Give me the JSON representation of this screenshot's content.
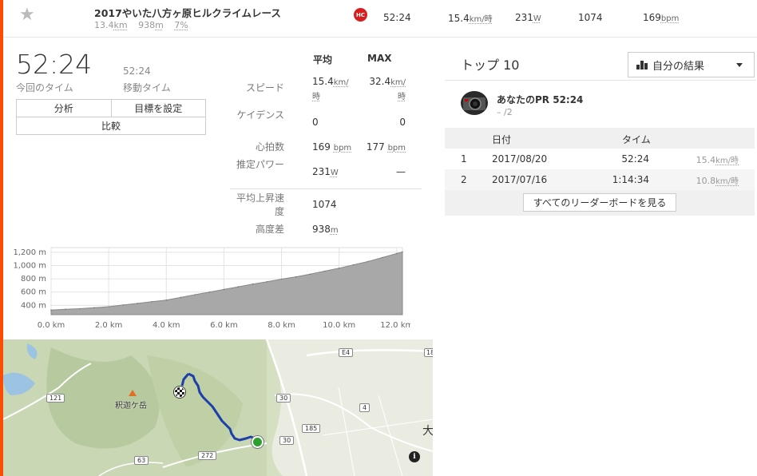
{
  "colors": {
    "accent": "#fc4c02",
    "route": "#1c3faa",
    "hc_badge": "#d61e1e",
    "end_marker": "#2ca02c",
    "elev_fill": "#a8a8a8"
  },
  "segment": {
    "star_icon": "★",
    "title": "2017やいた八方ヶ原ヒルクライムレース",
    "distance_val": "13.4",
    "distance_unit": "km",
    "elev_val": "938",
    "elev_unit": "m",
    "grade": "7%",
    "category": "HC",
    "time": "52:24",
    "speed_val": "15.4",
    "speed_unit": "km/時",
    "power_val": "231",
    "power_unit": "W",
    "vam": "1074",
    "hr_val": "169",
    "hr_unit": "bpm"
  },
  "summary": {
    "time": "52:24",
    "time_label": "今回のタイム",
    "moving_time": "52:24",
    "moving_label": "移動タイム",
    "buttons": {
      "analysis": "分析",
      "set_goal": "目標を設定",
      "compare": "比較"
    }
  },
  "stats": {
    "avg_header": "平均",
    "max_header": "MAX",
    "rows": [
      {
        "label": "スピード",
        "avg": "15.4",
        "avg_unit": "km/時",
        "max": "32.4",
        "max_unit": "km/時"
      },
      {
        "label": "ケイデンス",
        "avg": "0",
        "avg_unit": "",
        "max": "0",
        "max_unit": ""
      },
      {
        "label": "心拍数",
        "avg": "169",
        "avg_unit": "bpm",
        "max": "177",
        "max_unit": "bpm"
      },
      {
        "label": "推定パワー",
        "avg": "231",
        "avg_unit": "W",
        "max": "—",
        "max_unit": ""
      },
      {
        "label": "平均上昇速度",
        "avg": "1074",
        "avg_unit": "",
        "max": "",
        "max_unit": ""
      },
      {
        "label": "高度差",
        "avg": "938",
        "avg_unit": "m",
        "max": "",
        "max_unit": ""
      }
    ]
  },
  "chart_data": {
    "type": "area",
    "xlabel": "",
    "ylabel": "",
    "xlim": [
      0,
      12.2
    ],
    "ylim": [
      260,
      1270
    ],
    "x_ticks": [
      {
        "v": 0,
        "label": "0.0 km"
      },
      {
        "v": 2,
        "label": "2.0 km"
      },
      {
        "v": 4,
        "label": "4.0 km"
      },
      {
        "v": 6,
        "label": "6.0 km"
      },
      {
        "v": 8,
        "label": "8.0 km"
      },
      {
        "v": 10,
        "label": "10.0 km"
      },
      {
        "v": 12,
        "label": "12.0 km"
      }
    ],
    "y_ticks": [
      {
        "v": 400,
        "label": "400 m"
      },
      {
        "v": 600,
        "label": "600 m"
      },
      {
        "v": 800,
        "label": "800 m"
      },
      {
        "v": 1000,
        "label": "1,000 m"
      },
      {
        "v": 1200,
        "label": "1,200 m"
      }
    ],
    "x": [
      0,
      0.5,
      1,
      1.5,
      2,
      2.5,
      3,
      3.5,
      4,
      4.5,
      5,
      5.5,
      6,
      6.5,
      7,
      7.5,
      8,
      8.5,
      9,
      9.5,
      10,
      10.5,
      11,
      11.5,
      12,
      12.2
    ],
    "y": [
      330,
      340,
      350,
      365,
      380,
      405,
      430,
      455,
      480,
      520,
      560,
      600,
      640,
      680,
      720,
      755,
      795,
      830,
      870,
      915,
      960,
      1010,
      1060,
      1120,
      1180,
      1205
    ],
    "grid": true
  },
  "leaderboard": {
    "title": "トップ 10",
    "filter_label": "自分の結果",
    "pr_text": "あなたのPR 52:24",
    "pr_rank": "– /2",
    "headers": {
      "rank": "",
      "date": "日付",
      "time": "タイム",
      "speed": ""
    },
    "rows": [
      {
        "rank": "1",
        "date": "2017/08/20",
        "time": "52:24",
        "speed": "15.4",
        "speed_unit": "km/時"
      },
      {
        "rank": "2",
        "date": "2017/07/16",
        "time": "1:14:34",
        "speed": "10.8",
        "speed_unit": "km/時"
      }
    ],
    "view_all": "すべてのリーダーボードを見る"
  },
  "map": {
    "peak_label": "釈迦ケ岳",
    "road_labels": [
      "121",
      "30",
      "E4",
      "4",
      "185",
      "30",
      "272",
      "63"
    ],
    "corner_text": "大",
    "corner_num": "182",
    "info_icon": "i"
  }
}
